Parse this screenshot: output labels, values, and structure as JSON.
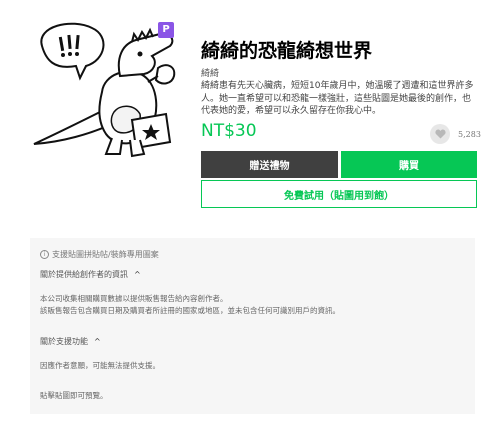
{
  "badge": "P",
  "title": "綺綺的恐龍綺想世界",
  "author": "綺綺",
  "description": "綺綺患有先天心臟病，短短10年歲月中，她溫暖了週遭和這世界許多人。她一直希望可以和恐龍一樣強壯，這些貼圖是她最後的創作，也代表她的愛，希望可以永久留存在你我心中。",
  "price": "NT$30",
  "likes": "5,283",
  "buttons": {
    "gift": "贈送禮物",
    "buy": "購買",
    "trial": "免費試用（貼圖用到飽）"
  },
  "info": {
    "note": "支援貼圖拼貼帖/裝飾專用圖案",
    "section1_title": "關於提供給創作者的資訊",
    "section1_lines": [
      "本公司收集相關購買數據以提供販售報告給內容創作者。",
      "該販售報告包含購買日期及購買者所註冊的國家或地區，並未包含任何可識別用戶的資訊。"
    ],
    "section2_title": "關於支援功能",
    "section2_line": "因應作者意願，可能無法提供支援。",
    "footer": "貼擊貼圖即可預覽。"
  }
}
